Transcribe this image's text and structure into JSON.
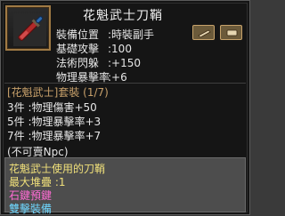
{
  "item": {
    "name": "花魁武士刀鞘",
    "icon": "sword-icon",
    "tag_icon": "sheath-icon"
  },
  "stats": [
    {
      "label": "裝備位置",
      "value": ":時裝副手"
    },
    {
      "label": "基礎攻擊",
      "value": ":100"
    },
    {
      "label": "法術閃躲",
      "value": ":+150"
    },
    {
      "label": "物理暴擊率",
      "value": ":+6"
    }
  ],
  "set": {
    "title": "[花魁武士]套裝 (1/7)",
    "bonuses": [
      "3件 :物理傷害+50",
      "5件 :物理暴擊率+3",
      "7件 :物理暴擊率+7"
    ],
    "npc_note": "(不可賣Npc)"
  },
  "description": {
    "line1": "花魁武士使用的刀鞘",
    "line2": "最大堆疊 :1",
    "line3": "石鍵預鍵",
    "line4": "雙擊裝備"
  },
  "colors": {
    "set_title": "#c7a06a",
    "desc_text": "#f0e07a",
    "desc_pink": "#ff6bd4",
    "desc_cyan": "#6fd7ff"
  }
}
